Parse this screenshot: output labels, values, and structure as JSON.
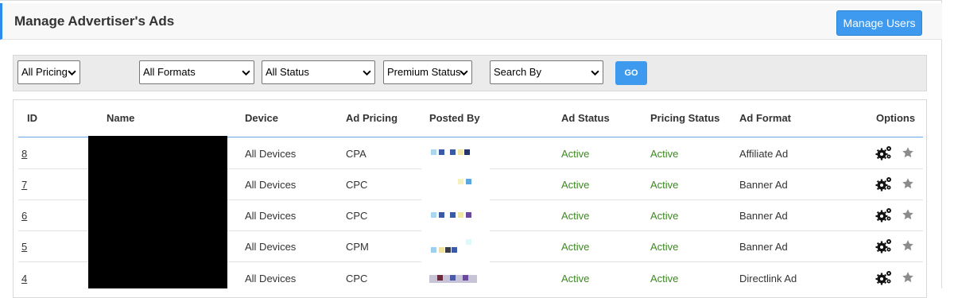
{
  "header": {
    "title": "Manage Advertiser's Ads",
    "manage_users_label": "Manage Users"
  },
  "filters": {
    "pricing": "All Pricing",
    "formats": "All Formats",
    "status": "All Status",
    "premium": "Premium Status",
    "search_by": "Search By",
    "go_label": "GO"
  },
  "table": {
    "columns": {
      "id": "ID",
      "name": "Name",
      "device": "Device",
      "ad_pricing": "Ad Pricing",
      "posted_by": "Posted By",
      "ad_status": "Ad Status",
      "pricing_status": "Pricing Status",
      "ad_format": "Ad Format",
      "options": "Options"
    },
    "rows": [
      {
        "id": "8",
        "device": "All Devices",
        "pricing": "CPA",
        "ad_status": "Active",
        "pricing_status": "Active",
        "format": "Affiliate Ad"
      },
      {
        "id": "7",
        "device": "All Devices",
        "pricing": "CPC",
        "ad_status": "Active",
        "pricing_status": "Active",
        "format": "Banner Ad"
      },
      {
        "id": "6",
        "device": "All Devices",
        "pricing": "CPC",
        "ad_status": "Active",
        "pricing_status": "Active",
        "format": "Banner Ad"
      },
      {
        "id": "5",
        "device": "All Devices",
        "pricing": "CPM",
        "ad_status": "Active",
        "pricing_status": "Active",
        "format": "Banner Ad"
      },
      {
        "id": "4",
        "device": "All Devices",
        "pricing": "CPC",
        "ad_status": "Active",
        "pricing_status": "Active",
        "format": "Directlink Ad"
      }
    ]
  },
  "icons": {
    "options_settings": "gears-icon",
    "options_feature": "star-icon",
    "select_arrow": "chevron-down-icon"
  },
  "colors": {
    "accent": "#3d9aee",
    "status_green": "#3a8a1e",
    "header_line": "#6aa9e9"
  }
}
